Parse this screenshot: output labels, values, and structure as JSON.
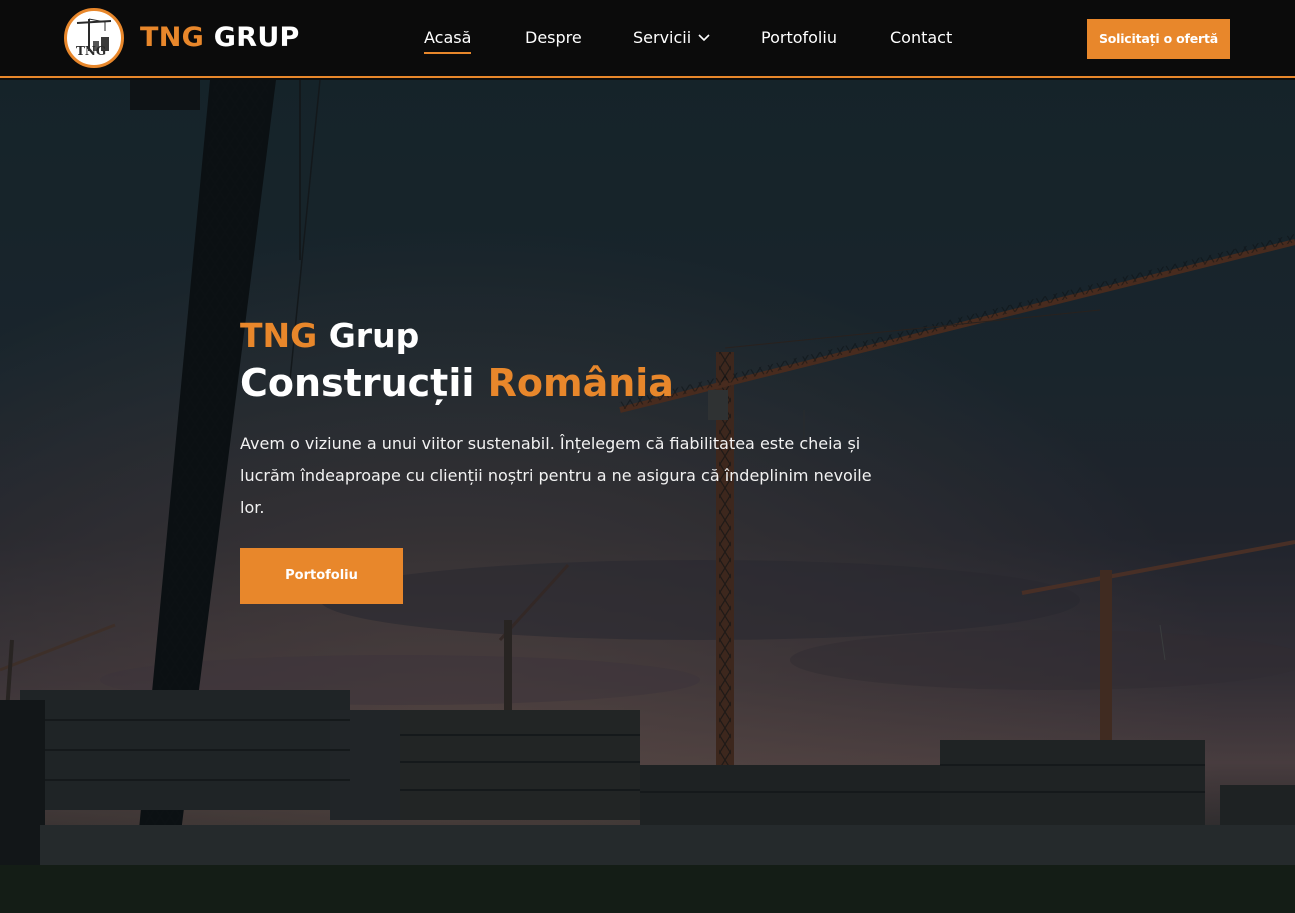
{
  "brand": {
    "name_part1": "TNG",
    "name_part2": "GRUP",
    "logo_text": "TNG",
    "accent_color": "#e8872b"
  },
  "nav": {
    "items": [
      {
        "label": "Acasă",
        "active": true
      },
      {
        "label": "Despre"
      },
      {
        "label": "Servicii",
        "has_dropdown": true,
        "dropdown_icon": "chevron-down-icon"
      },
      {
        "label": "Portofoliu"
      },
      {
        "label": "Contact"
      }
    ]
  },
  "header_cta": {
    "label": "Solicitați o ofertă"
  },
  "hero": {
    "title_part1": "TNG",
    "title_part2": "Grup",
    "subtitle_part1": "Construcții",
    "subtitle_part2": "România",
    "description": "Avem o viziune a unui viitor sustenabil. Înțelegem că fiabilitatea este cheia și lucrăm îndeaproape cu clienții noștri pentru a ne asigura că îndeplinim nevoile lor.",
    "button_label": "Portofoliu"
  }
}
